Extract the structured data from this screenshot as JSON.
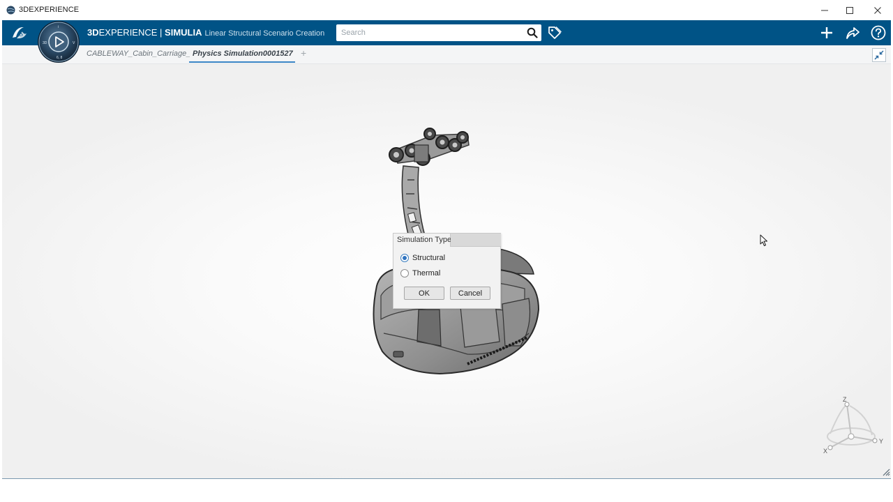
{
  "window": {
    "title": "3DEXPERIENCE",
    "controls": {
      "minimize": "minimize-icon",
      "maximize": "maximize-icon",
      "close": "close-icon"
    }
  },
  "appbar": {
    "brand_3d": "3D",
    "brand_experience": "EXPERIENCE | ",
    "brand_product": "SIMULIA",
    "app_name": "Linear Structural Scenario Creation",
    "search_placeholder": "Search",
    "accent_color": "#005386",
    "icons": [
      "ds-logo-icon",
      "compass-icon",
      "search-icon",
      "tag-icon",
      "plus-icon",
      "share-icon",
      "help-icon"
    ]
  },
  "tabs": [
    {
      "label": "CABLEWAY_Cabin_Carriage_A",
      "active": false
    },
    {
      "label": "Physics Simulation0001527",
      "active": true
    }
  ],
  "tab_add": "+",
  "dialog": {
    "title": "Simulation Type",
    "options": [
      {
        "label": "Structural",
        "checked": true
      },
      {
        "label": "Thermal",
        "checked": false
      }
    ],
    "ok_label": "OK",
    "cancel_label": "Cancel"
  },
  "triad": {
    "x_label": "X",
    "y_label": "Y",
    "z_label": "Z"
  }
}
